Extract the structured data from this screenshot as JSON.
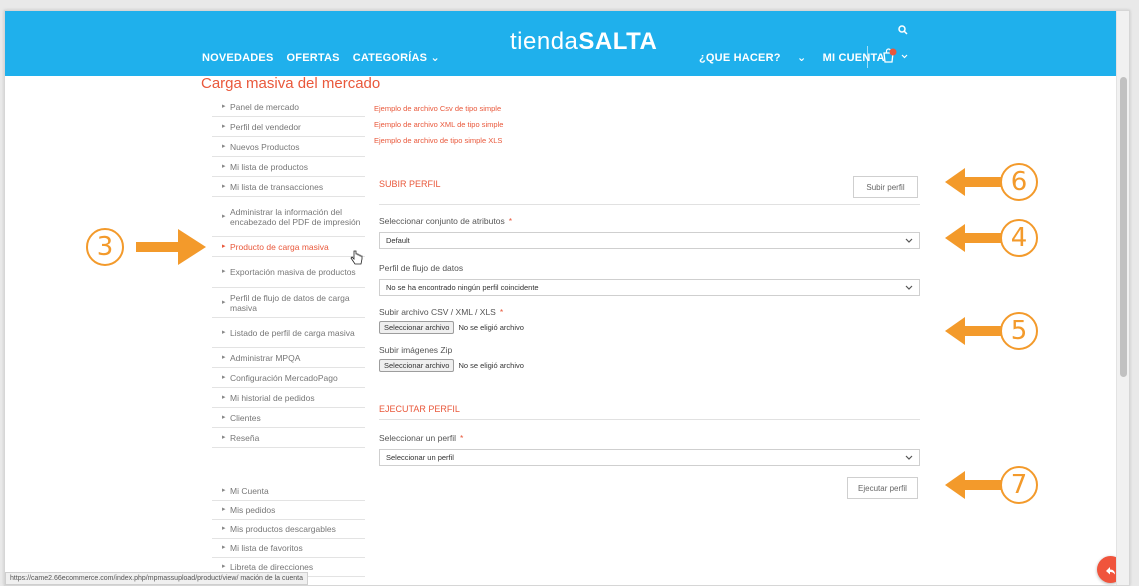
{
  "header": {
    "logo_part1": "tienda",
    "logo_part2": "SALTA",
    "nav_left": [
      "NOVEDADES",
      "OFERTAS",
      "CATEGORÍAS ⌄"
    ],
    "nav_right": [
      "¿QUE HACER?",
      "⌄",
      "MI CUENTA"
    ],
    "cart_badge": "0"
  },
  "page": {
    "title": "Carga masiva del mercado"
  },
  "sidebar": {
    "items": [
      {
        "label": "Panel de mercado"
      },
      {
        "label": "Perfil del vendedor"
      },
      {
        "label": "Nuevos Productos"
      },
      {
        "label": "Mi lista de productos"
      },
      {
        "label": "Mi lista de transacciones"
      },
      {
        "label": "Administrar la información del encabezado del PDF de impresión"
      },
      {
        "label": "Producto de carga masiva"
      },
      {
        "label": "Exportación masiva de productos"
      },
      {
        "label": "Perfil de flujo de datos de carga masiva"
      },
      {
        "label": "Listado de perfil de carga masiva"
      },
      {
        "label": "Administrar MPQA"
      },
      {
        "label": "Configuración MercadoPago"
      },
      {
        "label": "Mi historial de pedidos"
      },
      {
        "label": "Clientes"
      },
      {
        "label": "Reseña"
      }
    ],
    "account_items": [
      {
        "label": "Mi Cuenta"
      },
      {
        "label": "Mis pedidos"
      },
      {
        "label": "Mis productos descargables"
      },
      {
        "label": "Mi lista de favoritos"
      },
      {
        "label": "Libreta de direcciones"
      }
    ]
  },
  "sample_links": [
    "Ejemplo de archivo Csv de tipo simple",
    "Ejemplo de archivo XML de tipo simple",
    "Ejemplo de archivo de tipo simple XLS"
  ],
  "upload": {
    "section_title": "SUBIR PERFIL",
    "submit_label": "Subir perfil",
    "attr_set_label": "Seleccionar conjunto de atributos",
    "attr_set_value": "Default",
    "dataflow_label": "Perfil de flujo de datos",
    "dataflow_value": "No se ha encontrado ningún perfil coincidente",
    "file_label": "Subir archivo CSV / XML / XLS",
    "file_button": "Seleccionar archivo",
    "file_status": "No se eligió archivo",
    "zip_label": "Subir imágenes Zip",
    "zip_button": "Seleccionar archivo",
    "zip_status": "No se eligió archivo",
    "required_mark": "*"
  },
  "execute": {
    "section_title": "EJECUTAR PERFIL",
    "profile_label": "Seleccionar un perfil",
    "profile_value": "Seleccionar un perfil",
    "button_label": "Ejecutar perfil",
    "required_mark": "*"
  },
  "status_bar": {
    "url": "https://came2.66ecommerce.com/index.php/mpmassupload/product/view/",
    "trailing": "mación de la cuenta"
  },
  "annotations": {
    "three": "3",
    "four": "4",
    "five": "5",
    "six": "6",
    "seven": "7"
  },
  "colors": {
    "header_bg": "#1fb0ec",
    "accent": "#e9583b",
    "annotation": "#f39a2b"
  }
}
